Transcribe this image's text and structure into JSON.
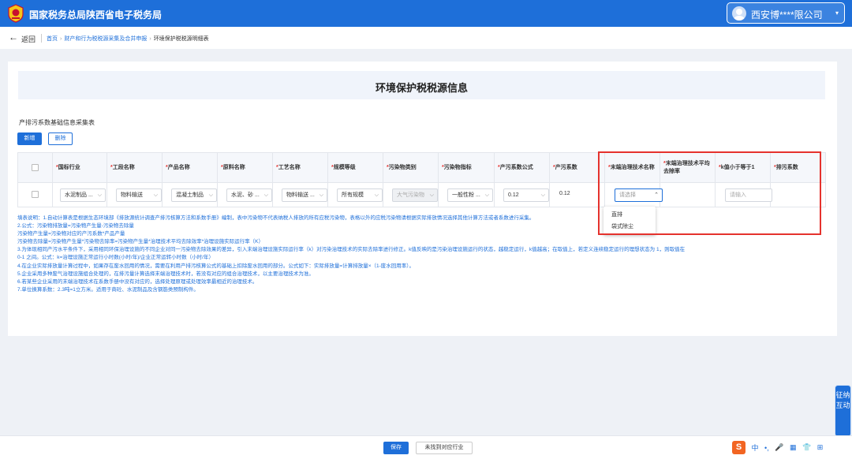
{
  "header": {
    "site_title": "国家税务总局陕西省电子税务局",
    "user_name": "西安博****限公司",
    "user_caret": "▾"
  },
  "nav": {
    "back_icon": "←",
    "back_label": "返回",
    "breadcrumb": [
      {
        "label": "首页"
      },
      {
        "label": "财产和行为税税源采集及合并申报"
      },
      {
        "label": "环境保护税税源明细表"
      }
    ],
    "breadcrumb_sep": "›"
  },
  "page": {
    "title": "环境保护税税源信息"
  },
  "section": {
    "title": "产排污系数基础信息采集表",
    "add_button": "新增",
    "delete_button": "删除"
  },
  "table": {
    "columns": [
      {
        "label": "国标行业",
        "required": true
      },
      {
        "label": "工段名称",
        "required": true
      },
      {
        "label": "产品名称",
        "required": true
      },
      {
        "label": "原料名称",
        "required": true
      },
      {
        "label": "工艺名称",
        "required": true
      },
      {
        "label": "规模等级",
        "required": true
      },
      {
        "label": "污染物类别",
        "required": true
      },
      {
        "label": "污染物指标",
        "required": true
      },
      {
        "label": "产污系数公式",
        "required": true
      },
      {
        "label": "产污系数",
        "required": true
      },
      {
        "label": "末端治理技术名称",
        "required": true
      },
      {
        "label": "末端治理技术平均去除率",
        "required": true
      },
      {
        "label": "k值小于等于1",
        "required": true
      },
      {
        "label": "排污系数",
        "required": true
      }
    ],
    "row": {
      "industry": "水泥制品 ...",
      "section": "物料输送",
      "product": "混凝土制品",
      "material": "水泥、砂 ...",
      "process": "物料输送 ...",
      "scale": "所有规模",
      "pollutant_category": "大气污染物",
      "pollutant_indicator": "一般性粉 ...",
      "formula": "0.12",
      "coefficient": "0.12",
      "treatment_placeholder": "请选择",
      "removal_rate": "",
      "k_placeholder": "请输入",
      "emission_coefficient": ""
    },
    "dropdown_options": [
      "直排",
      "袋式除尘"
    ]
  },
  "notes": [
    "填表说明：1.自动计算表是根据生态环境部《排放源统计调查产排污核算方法和系数手册》编制，表中污染物不代表纳税人排放的所有应税污染物，表格以外的应税污染物请根据实际排放情况选择其他计算方法或者系数进行采集。",
    "2.公式：污染物排放量=污染物产生量-污染物去除量",
    "污染物产生量=污染物对应的产污系数*产品产量",
    "污染物去除量=污染物产生量*污染物去除率=污染物产生量*治理技术平均去除效率*治理设施实际运行率（K）",
    "3.为体现相同产污水平条件下，采用相同环保治理设施的不同企业对同一污染物去除效果的差异，引入末端治理设施实际运行率（k）对污染治理技术的实际去除率进行修正。k值反映的是污染治理设施运行的状态，越稳定运行，k值越高；在取值上，若定义连续稳定运行的理想状态为 1，则取值在",
    "0-1 之间。公式：k=治理设施正常运行小时数(小时/年)/企业正常运转小时数（小时/年）",
    "4.在企业实际排放量计算过程中，如果存在废水回用的情况，需要在利用产排污核算公式的基础上扣除废水回用的部分。公式如下：实际排放量=计算排放量×（1-废水回用率）。",
    "5.企业采用多种废气治理设施组合处理的，在排污量计算选择末端治理技术时，若没有对应的组合治理技术，以主要治理技术为准。",
    "6.若某些企业采用的末端治理技术在系数手册中没有对应的，选择处理原理或处理效率最相近的治理技术。",
    "7.单位换算系数：2.3吨=1立方米。适用于商砼、水泥制品及含钢筋类预制构件。"
  ],
  "footer": {
    "save_button": "保存",
    "not_found_button": "未找到对应行业",
    "ime_logo": "S",
    "ime_items": [
      "中",
      "•,",
      "🎤",
      "▦",
      "👕",
      "⊞"
    ]
  },
  "side_tab": {
    "label": "征纳互动"
  },
  "colors": {
    "primary": "#1e6fd9",
    "required_mark": "#e5322d",
    "highlight_box": "#e5322d"
  }
}
